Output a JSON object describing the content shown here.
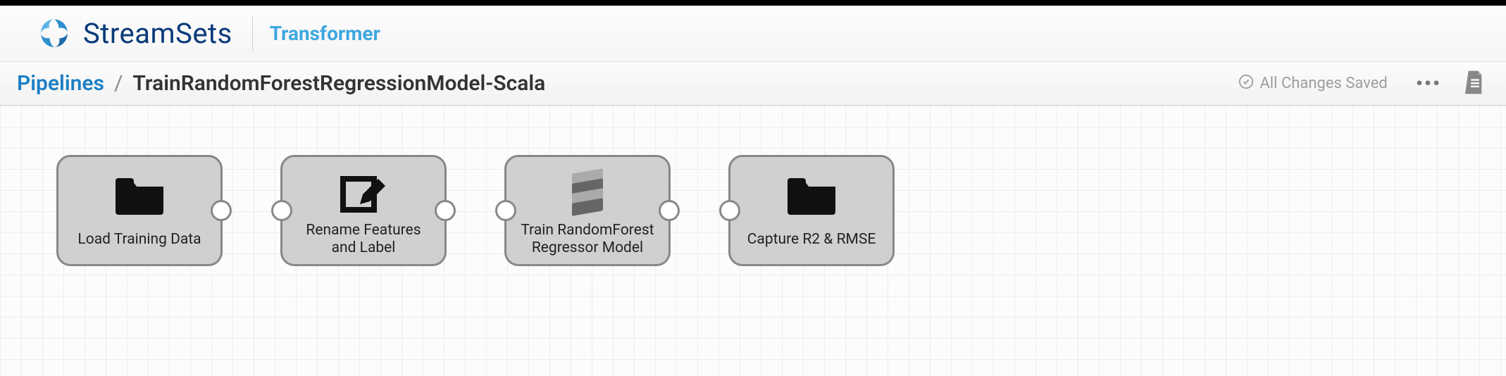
{
  "header": {
    "brand": "StreamSets",
    "product": "Transformer"
  },
  "breadcrumb": {
    "root": "Pipelines",
    "separator": "/",
    "current": "TrainRandomForestRegressionModel-Scala"
  },
  "status": {
    "text": "All Changes Saved"
  },
  "pipeline": {
    "nodes": [
      {
        "label": "Load Training Data",
        "icon": "folder",
        "in": false,
        "out": true
      },
      {
        "label": "Rename Features\nand Label",
        "icon": "edit",
        "in": true,
        "out": true
      },
      {
        "label": "Train RandomForest\nRegressor Model",
        "icon": "scala",
        "in": true,
        "out": true
      },
      {
        "label": "Capture R2 & RMSE",
        "icon": "folder",
        "in": true,
        "out": false
      }
    ]
  }
}
